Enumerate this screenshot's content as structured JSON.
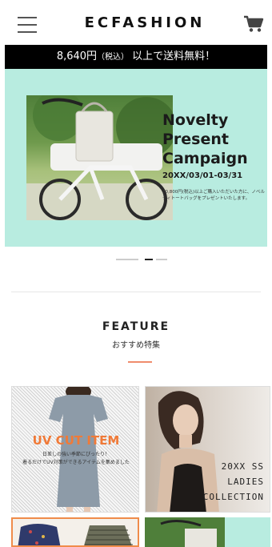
{
  "header": {
    "logo": "ECFASHION",
    "menu_icon": "hamburger-menu-icon",
    "cart_icon": "shopping-cart-icon"
  },
  "promo": {
    "price": "8,640円",
    "tax": "（税込）",
    "text": "以上で送料無料！"
  },
  "hero": {
    "title_line1": "Novelty",
    "title_line2": "Present",
    "title_line3": "Campaign",
    "date": "20XX/03/01-03/31",
    "note": "10,800円(税込)以上ご購入いただいた方に、ノベルティトートバッグをプレゼントいたします。",
    "bg_color": "#b8ece0"
  },
  "carousel": {
    "slides": 3,
    "active_index": 1
  },
  "feature": {
    "title": "FEATURE",
    "subtitle": "おすすめ特集",
    "accent_color": "#f08c6c"
  },
  "cards": [
    {
      "title": "UV CUT ITEM",
      "desc_line1": "日差しの強い季節にぴったり！",
      "desc_line2": "着るだけでUV対策ができるアイテムを集めました",
      "accent_color": "#f07a38"
    },
    {
      "line1": "20XX SS",
      "line2": "LADIES",
      "line3": "COLLECTION"
    }
  ]
}
